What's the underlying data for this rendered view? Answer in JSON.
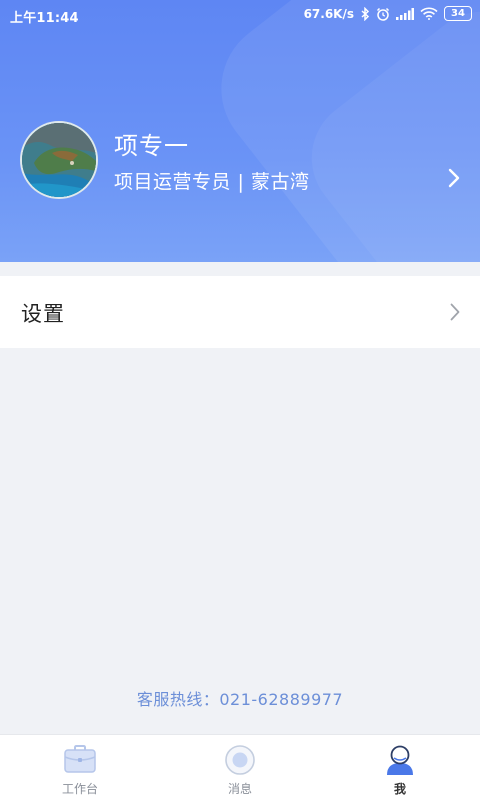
{
  "status_bar": {
    "time": "上午11:44",
    "net_speed": "67.6K/s",
    "battery": "34"
  },
  "profile": {
    "name": "项专一",
    "role": "项目运营专员 | 蒙古湾"
  },
  "settings": {
    "label": "设置"
  },
  "hotline": {
    "text": "客服热线：021-62889977"
  },
  "tabbar": {
    "tabs": [
      {
        "label": "工作台",
        "icon": "briefcase-icon",
        "active": false
      },
      {
        "label": "消息",
        "icon": "message-icon",
        "active": false
      },
      {
        "label": "我",
        "icon": "profile-icon",
        "active": true
      }
    ]
  },
  "colors": {
    "header_gradient": [
      "#5e86f3",
      "#7aa2f7"
    ],
    "hotline": "#6c8fd8",
    "active_tab": "#4a78e8",
    "background": "#f0f2f6"
  }
}
